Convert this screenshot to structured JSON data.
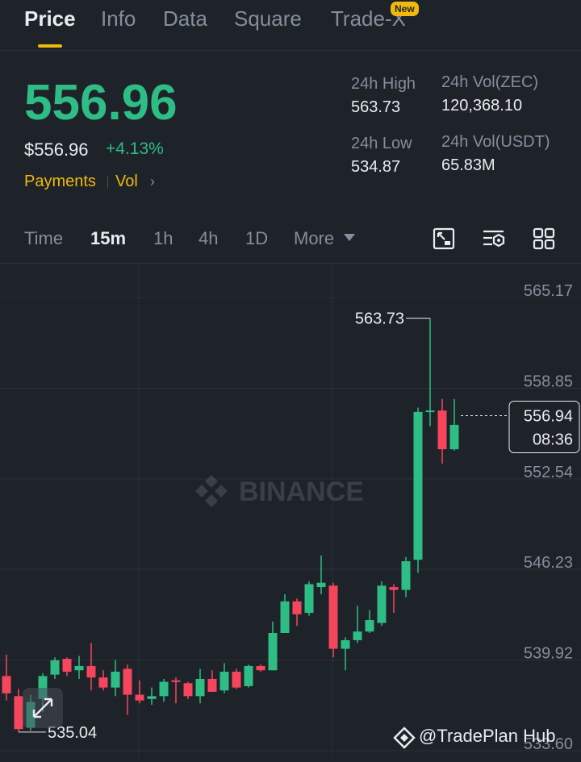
{
  "tabs": [
    {
      "label": "Price",
      "active": true
    },
    {
      "label": "Info",
      "active": false
    },
    {
      "label": "Data",
      "active": false
    },
    {
      "label": "Square",
      "active": false
    },
    {
      "label": "Trade-X",
      "active": false,
      "badge": "New"
    }
  ],
  "ticker": {
    "price": "556.96",
    "usd_price": "$556.96",
    "change_pct": "+4.13%",
    "payments_label": "Payments",
    "vol_label": "Vol"
  },
  "stats": {
    "high_label": "24h High",
    "high_value": "563.73",
    "low_label": "24h Low",
    "low_value": "534.87",
    "vol_base_label": "24h Vol(ZEC)",
    "vol_base_value": "120,368.10",
    "vol_quote_label": "24h Vol(USDT)",
    "vol_quote_value": "65.83M"
  },
  "timeframes": [
    {
      "label": "Time",
      "active": false
    },
    {
      "label": "15m",
      "active": true
    },
    {
      "label": "1h",
      "active": false
    },
    {
      "label": "4h",
      "active": false
    },
    {
      "label": "1D",
      "active": false
    },
    {
      "label": "More",
      "active": false
    }
  ],
  "icons": [
    "chart-settings-icon",
    "indicators-icon",
    "grid-icon",
    "expand-icon"
  ],
  "colors": {
    "up": "#2ebd85",
    "down": "#f6465d",
    "accent": "#f0b90b",
    "bg": "#1e2329"
  },
  "watermark_text": "BINANCE",
  "footer_watermark": "@TradePlan Hub",
  "chart_data": {
    "type": "candlestick",
    "y_ticks": [
      "565.17",
      "558.85",
      "552.54",
      "546.23",
      "539.92",
      "533.60"
    ],
    "ylim": [
      533.6,
      566.5
    ],
    "high_label": "563.73",
    "low_label": "535.04",
    "current_price_label": "556.94",
    "countdown": "08:36",
    "candles": [
      {
        "o": 538.8,
        "h": 540.3,
        "l": 537.1,
        "c": 537.6
      },
      {
        "o": 537.4,
        "h": 537.9,
        "l": 534.9,
        "c": 535.1
      },
      {
        "o": 535.2,
        "h": 537.5,
        "l": 535.0,
        "c": 537.0
      },
      {
        "o": 537.2,
        "h": 539.0,
        "l": 536.3,
        "c": 538.8
      },
      {
        "o": 538.9,
        "h": 540.1,
        "l": 538.6,
        "c": 539.9
      },
      {
        "o": 540.0,
        "h": 540.1,
        "l": 538.8,
        "c": 539.1
      },
      {
        "o": 539.2,
        "h": 540.2,
        "l": 538.6,
        "c": 539.5
      },
      {
        "o": 539.5,
        "h": 541.1,
        "l": 537.8,
        "c": 538.7
      },
      {
        "o": 538.7,
        "h": 539.2,
        "l": 537.8,
        "c": 538.0
      },
      {
        "o": 538.0,
        "h": 539.9,
        "l": 537.4,
        "c": 539.1
      },
      {
        "o": 539.3,
        "h": 539.6,
        "l": 536.1,
        "c": 537.5
      },
      {
        "o": 537.5,
        "h": 538.5,
        "l": 536.9,
        "c": 537.1
      },
      {
        "o": 537.2,
        "h": 538.0,
        "l": 536.8,
        "c": 537.4
      },
      {
        "o": 537.4,
        "h": 538.6,
        "l": 537.0,
        "c": 538.4
      },
      {
        "o": 538.5,
        "h": 538.7,
        "l": 536.9,
        "c": 538.4
      },
      {
        "o": 538.3,
        "h": 538.4,
        "l": 537.2,
        "c": 537.4
      },
      {
        "o": 537.4,
        "h": 539.3,
        "l": 536.9,
        "c": 538.6
      },
      {
        "o": 538.6,
        "h": 539.2,
        "l": 537.7,
        "c": 537.7
      },
      {
        "o": 537.8,
        "h": 539.7,
        "l": 537.6,
        "c": 539.1
      },
      {
        "o": 539.1,
        "h": 539.3,
        "l": 537.9,
        "c": 538.0
      },
      {
        "o": 538.1,
        "h": 539.6,
        "l": 538.0,
        "c": 539.5
      },
      {
        "o": 539.5,
        "h": 539.6,
        "l": 539.1,
        "c": 539.2
      },
      {
        "o": 539.2,
        "h": 542.6,
        "l": 539.2,
        "c": 541.8
      },
      {
        "o": 541.8,
        "h": 544.5,
        "l": 541.8,
        "c": 544.0
      },
      {
        "o": 544.0,
        "h": 544.2,
        "l": 542.3,
        "c": 543.1
      },
      {
        "o": 543.2,
        "h": 545.4,
        "l": 543.0,
        "c": 545.2
      },
      {
        "o": 545.0,
        "h": 547.2,
        "l": 544.5,
        "c": 545.3
      },
      {
        "o": 545.1,
        "h": 545.3,
        "l": 540.1,
        "c": 540.7
      },
      {
        "o": 540.7,
        "h": 541.5,
        "l": 539.2,
        "c": 541.3
      },
      {
        "o": 541.3,
        "h": 543.7,
        "l": 541.1,
        "c": 541.9
      },
      {
        "o": 541.9,
        "h": 543.4,
        "l": 541.8,
        "c": 542.7
      },
      {
        "o": 542.5,
        "h": 545.4,
        "l": 542.3,
        "c": 545.1
      },
      {
        "o": 545.0,
        "h": 545.2,
        "l": 543.2,
        "c": 544.8
      },
      {
        "o": 544.8,
        "h": 547.1,
        "l": 544.3,
        "c": 546.8
      },
      {
        "o": 546.9,
        "h": 557.5,
        "l": 546.0,
        "c": 557.2
      },
      {
        "o": 557.2,
        "h": 563.73,
        "l": 556.2,
        "c": 557.3
      },
      {
        "o": 557.3,
        "h": 558.1,
        "l": 553.6,
        "c": 554.6
      },
      {
        "o": 554.6,
        "h": 558.1,
        "l": 554.5,
        "c": 556.3
      }
    ]
  }
}
